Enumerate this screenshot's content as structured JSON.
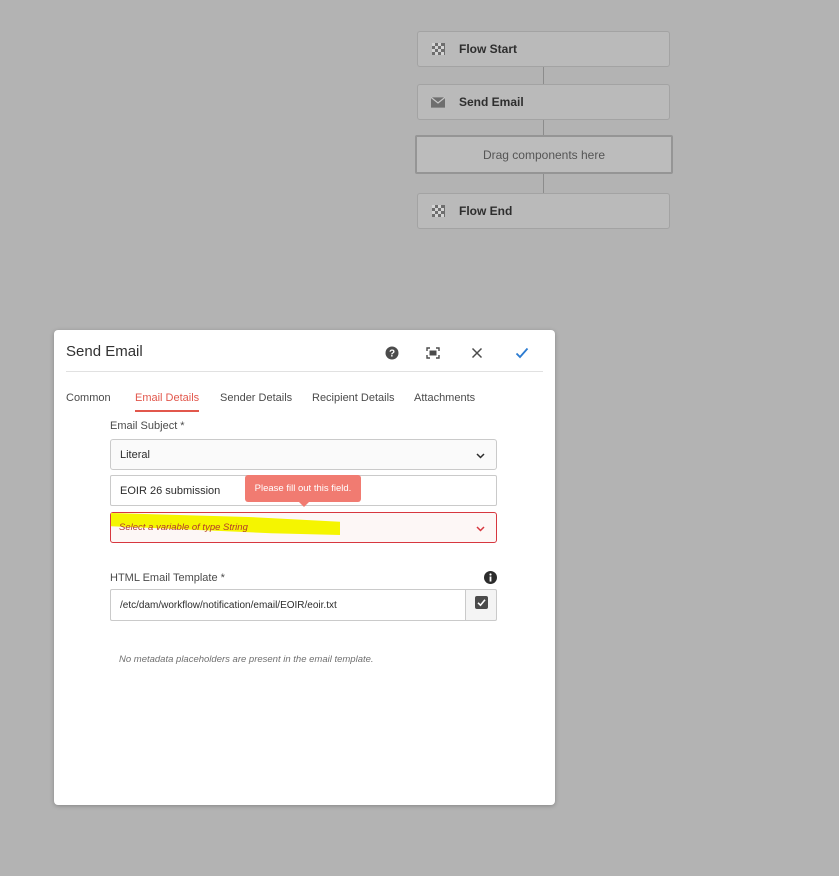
{
  "workflow": {
    "nodes": [
      {
        "label": "Flow Start",
        "icon": "checkered-flag-icon"
      },
      {
        "label": "Send Email",
        "icon": "envelope-icon"
      },
      {
        "label": "Flow End",
        "icon": "checkered-flag-icon"
      }
    ],
    "drop_zone": "Drag components here"
  },
  "dialog": {
    "title": "Send Email",
    "header_icons": [
      "help-icon",
      "fullscreen-icon",
      "close-icon",
      "checkmark-icon"
    ],
    "tabs": [
      {
        "label": "Common",
        "active": false
      },
      {
        "label": "Email Details",
        "active": true
      },
      {
        "label": "Sender Details",
        "active": false
      },
      {
        "label": "Recipient Details",
        "active": false
      },
      {
        "label": "Attachments",
        "active": false
      }
    ],
    "email_subject": {
      "label": "Email Subject *",
      "type_select": "Literal",
      "value": "EOIR 26 submission",
      "variable_placeholder": "Select a variable of type String",
      "validation_message": "Please fill out this field."
    },
    "template": {
      "label": "HTML Email Template *",
      "path": "/etc/dam/workflow/notification/email/EOIR/eoir.txt"
    },
    "note": "No metadata placeholders are present in the email template."
  },
  "colors": {
    "accent": "#e2574c",
    "confirm": "#2b7bd1",
    "error": "#d7373f",
    "tooltip": "#f17b71",
    "highlight": "#f5f500"
  }
}
